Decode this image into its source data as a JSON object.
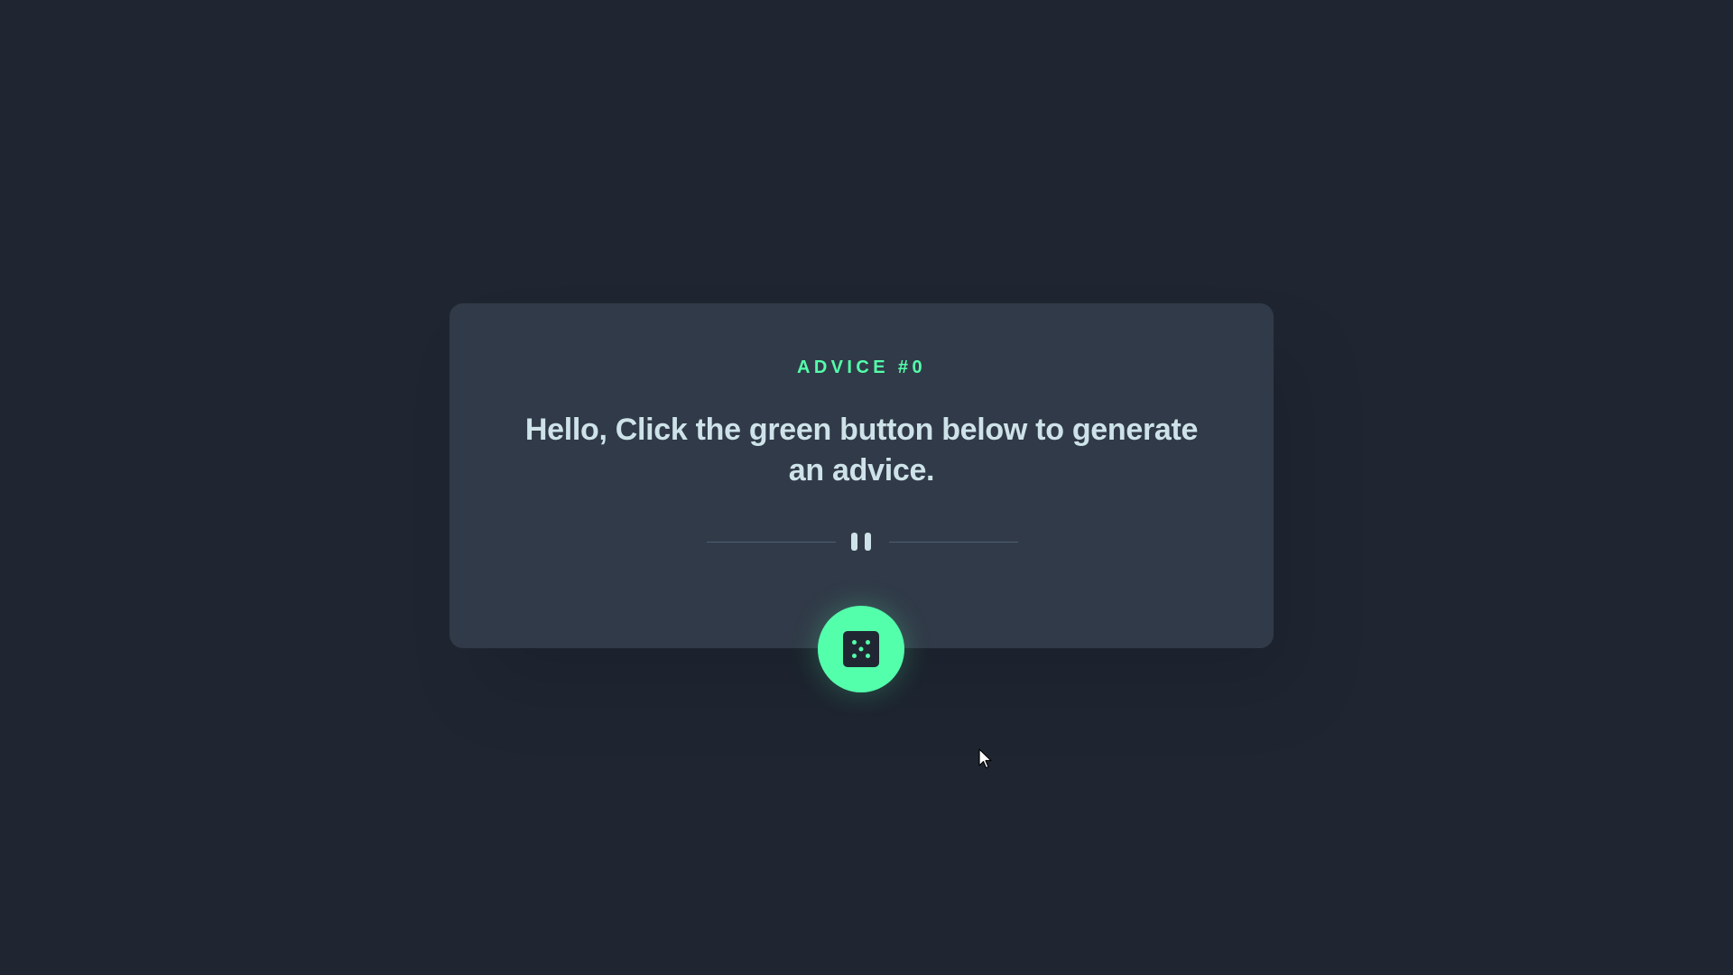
{
  "card": {
    "label": "ADVICE #0",
    "quote": "Hello, Click the green button below to generate an advice."
  },
  "divider": {
    "icon": "pause-icon"
  },
  "button": {
    "icon": "dice-icon",
    "action": "generate-advice"
  },
  "colors": {
    "background": "#1f2632",
    "card": "#313a48",
    "accent": "#53ffaa",
    "text": "#cee3e9",
    "divider": "#4f5d74"
  }
}
